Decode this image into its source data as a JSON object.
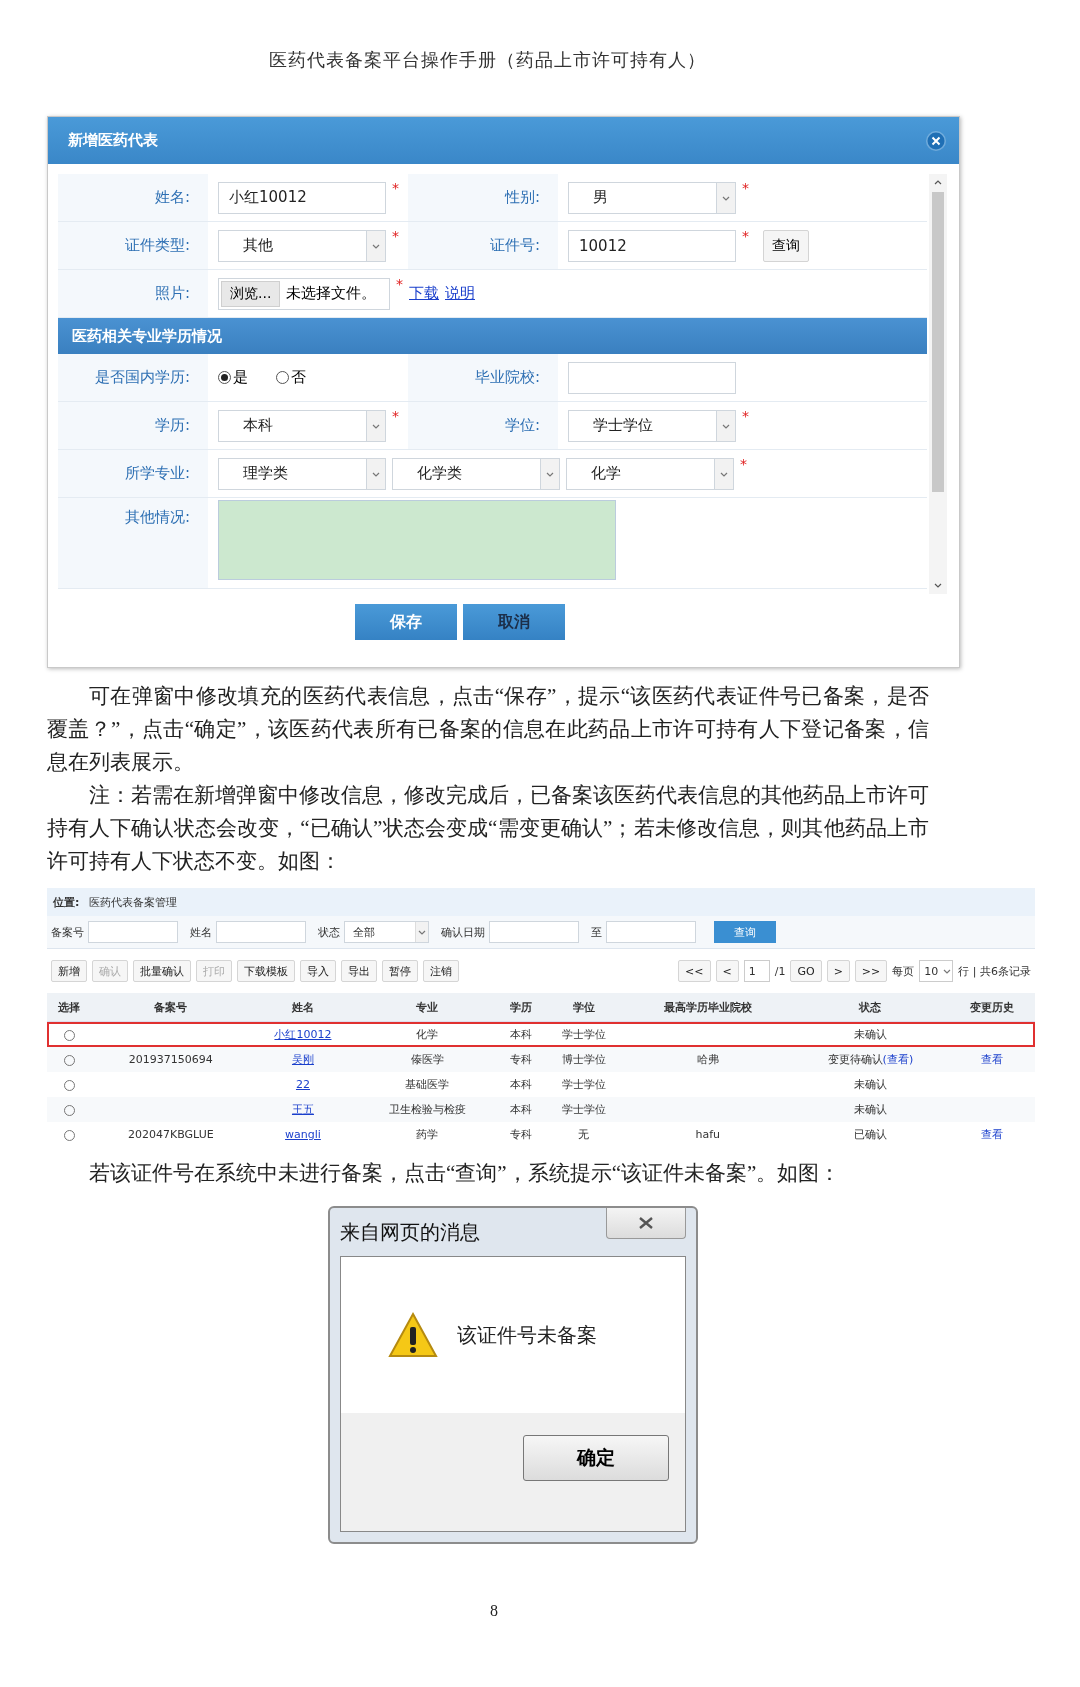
{
  "doc_header": "医药代表备案平台操作手册（药品上市许可持有人）",
  "dialog": {
    "title": "新增医药代表",
    "rows": [
      {
        "kind": "fields",
        "cells": [
          {
            "label": "姓名:",
            "kind": "input",
            "value": "小红10012",
            "mark": "*"
          },
          {
            "label": "性别:",
            "kind": "select",
            "value": "男",
            "mark": "*"
          }
        ]
      },
      {
        "kind": "fields",
        "cells": [
          {
            "label": "证件类型:",
            "kind": "select",
            "value": "其他",
            "mark": "*"
          },
          {
            "label": "证件号:",
            "kind": "input",
            "value": "10012",
            "mark": "*",
            "button": "查询"
          }
        ]
      },
      {
        "kind": "fields",
        "cells": [
          {
            "label": "照片:",
            "kind": "file",
            "button": "浏览...",
            "value": "未选择文件。",
            "mark": "*",
            "links": [
              "下载",
              "说明"
            ]
          }
        ]
      },
      {
        "kind": "section",
        "title": "医药相关专业学历情况"
      },
      {
        "kind": "fields",
        "cells": [
          {
            "label": "是否国内学历:",
            "kind": "radio",
            "options": [
              {
                "label": "是",
                "selected": true
              },
              {
                "label": "否",
                "selected": false
              }
            ]
          },
          {
            "label": "毕业院校:",
            "kind": "input"
          }
        ]
      },
      {
        "kind": "fields",
        "cells": [
          {
            "label": "学历:",
            "kind": "select",
            "value": "本科",
            "mark": "*"
          },
          {
            "label": "学位:",
            "kind": "select",
            "value": "学士学位",
            "mark": "*"
          }
        ]
      },
      {
        "kind": "fields",
        "cells": [
          {
            "label": "所学专业:",
            "kind": "selects",
            "values": [
              "理学类",
              "化学类",
              "化学"
            ],
            "mark": "*"
          }
        ]
      },
      {
        "kind": "fields",
        "cells": [
          {
            "label": "其他情况:",
            "kind": "textarea"
          }
        ]
      }
    ],
    "buttons": [
      "保存",
      "取消"
    ]
  },
  "paragraphs": [
    "可在弹窗中修改填充的医药代表信息，点击“保存”，提示“该医药代表证件号已备案，是否覆盖？”，点击“确定”，该医药代表所有已备案的信息在此药品上市许可持有人下登记备案，信息在列表展示。",
    "注：若需在新增弹窗中修改信息，修改完成后，已备案该医药代表信息的其他药品上市许可持有人下确认状态会改变，“已确认”状态会变成“需变更确认”；若未修改信息，则其他药品上市许可持有人下状态不变。如图："
  ],
  "list_page": {
    "location_label": "位置:",
    "location": "医药代表备案管理",
    "filters": [
      {
        "label": "备案号",
        "kind": "input"
      },
      {
        "label": "姓名",
        "kind": "input"
      },
      {
        "label": "状态",
        "kind": "select",
        "value": "全部"
      },
      {
        "label": "确认日期",
        "kind": "input"
      },
      {
        "label": "至",
        "kind": "input"
      }
    ],
    "search_button": "查询",
    "toolbar": [
      {
        "label": "新增",
        "disabled": false
      },
      {
        "label": "确认",
        "disabled": true
      },
      {
        "label": "批量确认",
        "disabled": false
      },
      {
        "label": "打印",
        "disabled": true
      },
      {
        "label": "下载模板",
        "disabled": false
      },
      {
        "label": "导入",
        "disabled": false
      },
      {
        "label": "导出",
        "disabled": false
      },
      {
        "label": "暂停",
        "disabled": false
      },
      {
        "label": "注销",
        "disabled": false
      }
    ],
    "pager": [
      {
        "kind": "button",
        "label": "<<"
      },
      {
        "kind": "button",
        "label": "<"
      },
      {
        "kind": "input",
        "value": "1"
      },
      {
        "kind": "text",
        "label": "/1"
      },
      {
        "kind": "button",
        "label": "GO"
      },
      {
        "kind": "button",
        "label": ">"
      },
      {
        "kind": "button",
        "label": ">>"
      },
      {
        "kind": "text",
        "label": "每页"
      },
      {
        "kind": "select",
        "value": "10"
      },
      {
        "kind": "text",
        "label": "行 | 共6条记录"
      }
    ],
    "table": {
      "columns": [
        "选择",
        "备案号",
        "姓名",
        "专业",
        "学历",
        "学位",
        "最高学历毕业院校",
        "状态",
        "变更历史"
      ],
      "rows": [
        {
          "selected": false,
          "highlighted": true,
          "name": "小红10012",
          "major": "化学",
          "education": "本科",
          "degree": "学士学位",
          "status": "未确认"
        },
        {
          "selected": false,
          "highlighted": false,
          "record_no": "201937150694",
          "name": "吴刚",
          "major": "傣医学",
          "education": "专科",
          "degree": "博士学位",
          "school": "哈弗",
          "status": "变更待确认",
          "status_link": "(查看)",
          "history": "查看"
        },
        {
          "selected": false,
          "highlighted": false,
          "name": "22",
          "major": "基础医学",
          "education": "本科",
          "degree": "学士学位",
          "status": "未确认"
        },
        {
          "selected": false,
          "highlighted": false,
          "name": "王五",
          "major": "卫生检验与检疫",
          "education": "本科",
          "degree": "学士学位",
          "status": "未确认"
        },
        {
          "selected": false,
          "highlighted": false,
          "record_no": "202047KBGLUE",
          "name": "wangli",
          "major": "药学",
          "education": "专科",
          "degree": "无",
          "school": "hafu",
          "status": "已确认",
          "history": "查看"
        }
      ]
    }
  },
  "paragraph_after_table": "若该证件号在系统中未进行备案，点击“查询”，系统提示“该证件未备案”。如图：",
  "message_box": {
    "title": "来自网页的消息",
    "message": "该证件号未备案",
    "button": "确定"
  },
  "page_number": "8"
}
